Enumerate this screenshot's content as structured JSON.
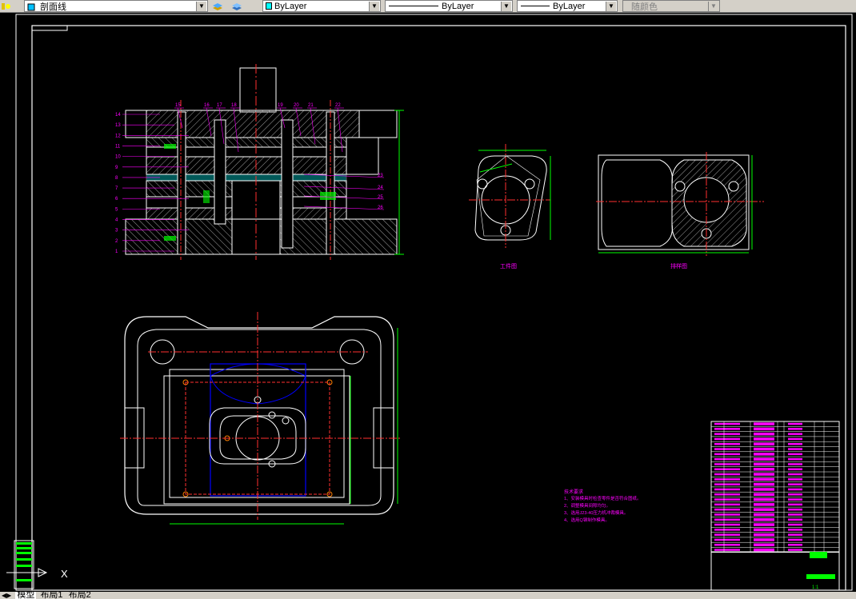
{
  "toolbar": {
    "layer_value": "剖面线",
    "color_value": "ByLayer",
    "linetype_value": "ByLayer",
    "lineweight_value": "ByLayer",
    "plotstyle_value": "随颜色"
  },
  "drawing": {
    "label_workpiece": "工件图",
    "label_layout": "排样图",
    "tech_req_title": "技术要求",
    "tech_req_lines": [
      "1、安装模具时检查零件是否符合图纸。",
      "2、调整模具间隙均匀。",
      "3、选用J23-40压力机冲裁模具。",
      "4、选用Q钢制作模具。"
    ],
    "part_numbers_left": [
      "14",
      "13",
      "12",
      "11",
      "10",
      "9",
      "8",
      "7",
      "6",
      "5",
      "4",
      "3",
      "2",
      "1"
    ],
    "part_numbers_top": [
      "15",
      "16",
      "17",
      "18",
      "19",
      "20",
      "21",
      "22"
    ],
    "part_numbers_right": [
      "23",
      "24",
      "25",
      "26"
    ],
    "scale_text": "1:1"
  },
  "tabs": {
    "model": "模型",
    "layout1": "布局1",
    "layout2": "布局2"
  },
  "colors": {
    "background": "#000000",
    "outline": "#ffffff",
    "dimension": "#00ff00",
    "centerline": "#ff3030",
    "annotation": "#ff00ff",
    "hatch": "#bbbbbb",
    "strip": "#0000ff"
  }
}
